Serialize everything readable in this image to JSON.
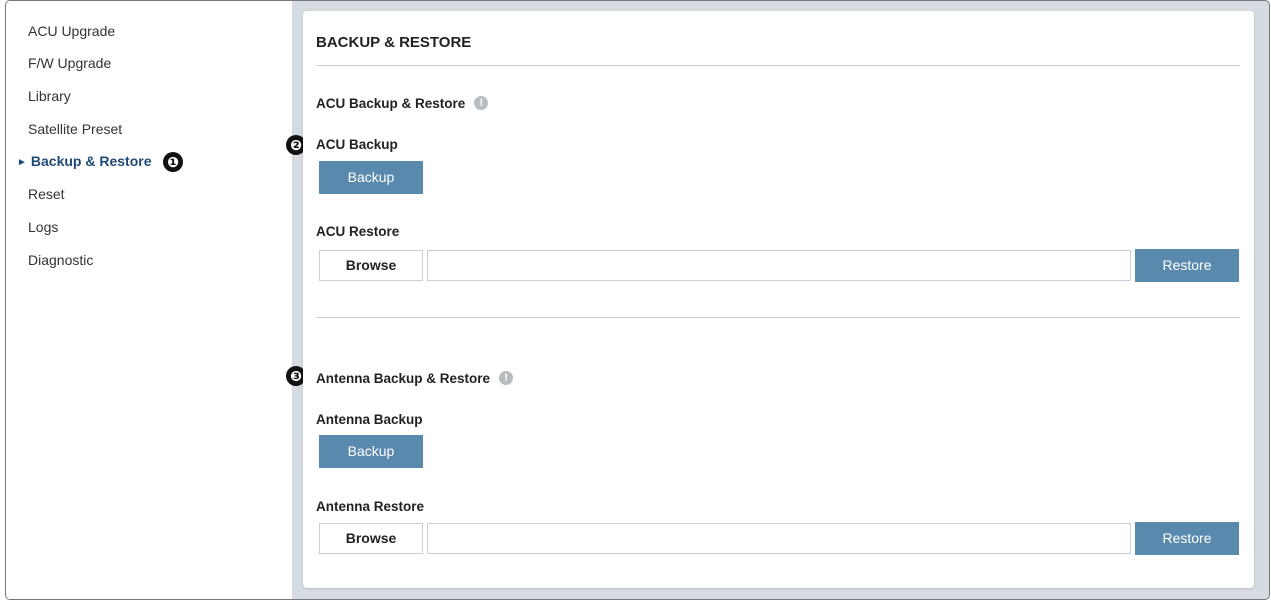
{
  "sidebar": {
    "items": [
      {
        "label": "ACU Upgrade"
      },
      {
        "label": "F/W Upgrade"
      },
      {
        "label": "Library"
      },
      {
        "label": "Satellite Preset"
      },
      {
        "label": "Backup & Restore",
        "active": true
      },
      {
        "label": "Reset"
      },
      {
        "label": "Logs"
      },
      {
        "label": "Diagnostic"
      }
    ],
    "active_marker": "►"
  },
  "callouts": [
    "❶",
    "❷",
    "❸"
  ],
  "panel": {
    "title": "BACKUP & RESTORE",
    "acu": {
      "section_title": "ACU Backup & Restore",
      "backup_label": "ACU Backup",
      "backup_button": "Backup",
      "restore_label": "ACU Restore",
      "browse_button": "Browse",
      "file_value": "",
      "restore_button": "Restore"
    },
    "antenna": {
      "section_title": "Antenna Backup & Restore",
      "backup_label": "Antenna Backup",
      "backup_button": "Backup",
      "restore_label": "Antenna Restore",
      "browse_button": "Browse",
      "file_value": "",
      "restore_button": "Restore"
    },
    "info_glyph": "!"
  },
  "colors": {
    "accent_button": "#5a89ae",
    "active_nav": "#1f4a78",
    "background": "#d5dbe0"
  }
}
